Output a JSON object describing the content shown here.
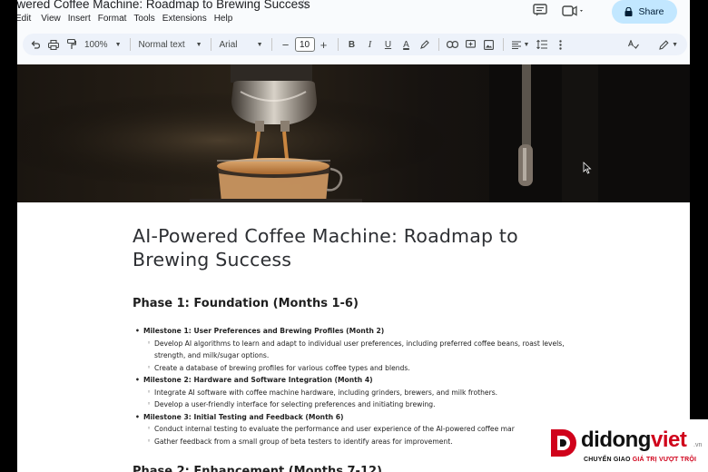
{
  "doc": {
    "title": "owered Coffee Machine: Roadmap to Brewing Success"
  },
  "menu": [
    "Edit",
    "View",
    "Insert",
    "Format",
    "Tools",
    "Extensions",
    "Help"
  ],
  "share_label": "Share",
  "toolbar": {
    "zoom": "100%",
    "style": "Normal text",
    "font": "Arial",
    "font_size": "10",
    "minus": "−",
    "plus": "+",
    "bold": "B",
    "italic": "I",
    "underline": "U",
    "text_color": "A"
  },
  "content": {
    "heading": "AI-Powered Coffee Machine: Roadmap to Brewing Success",
    "phase1": "Phase 1: Foundation (Months 1-6)",
    "milestones": [
      {
        "title": "Milestone 1: User Preferences and Brewing Profiles (Month 2)",
        "items": [
          "Develop AI algorithms to learn and adapt to individual user preferences, including preferred coffee beans, roast levels, strength, and milk/sugar options.",
          "Create a database of brewing profiles for various coffee types and blends."
        ]
      },
      {
        "title": "Milestone 2: Hardware and Software Integration (Month 4)",
        "items": [
          "Integrate AI software with coffee machine hardware, including grinders, brewers, and milk frothers.",
          "Develop a user-friendly interface for selecting preferences and initiating brewing."
        ]
      },
      {
        "title": "Milestone 3: Initial Testing and Feedback (Month 6)",
        "items": [
          "Conduct internal testing to evaluate the performance and user experience of the AI-powered coffee mar",
          "Gather feedback from a small group of beta testers to identify areas for improvement."
        ]
      }
    ],
    "phase2_cut": "Phase 2: Enhancement (Months 7-12)"
  },
  "watermark": {
    "brand_a": "didong",
    "brand_b": "viet",
    "tld": ".vn",
    "tag_a": "CHUYỂN GIAO",
    "tag_b": "GIÁ TRỊ VƯỢT TRỘI"
  },
  "colors": {
    "share_bg": "#c2e7ff",
    "toolbar_bg": "#edf2fa",
    "brand_red": "#d0021b"
  },
  "icons": [
    "star-icon",
    "comment-icon",
    "video-icon",
    "lock-icon",
    "undo-icon",
    "print-icon",
    "paint-format-icon",
    "link-icon",
    "comment-add-icon",
    "image-icon",
    "align-icon",
    "line-spacing-icon",
    "more-icon",
    "spellcheck-icon",
    "pencil-icon",
    "cursor-icon"
  ]
}
